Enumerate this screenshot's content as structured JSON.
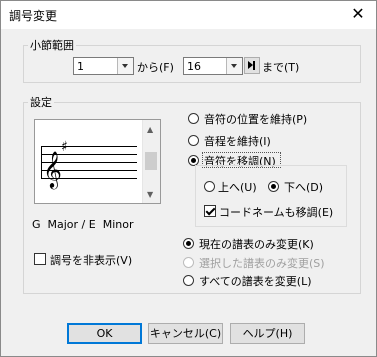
{
  "window": {
    "title": "調号変更",
    "close_icon": "close-icon"
  },
  "measure_range": {
    "legend": "小節範囲",
    "from_value": "1",
    "from_label": "から(F)",
    "to_value": "16",
    "to_label": "まで(T)"
  },
  "settings": {
    "legend": "設定",
    "key_label": "G  Major / E  Minor",
    "hide_key_label": "調号を非表示(V)",
    "pitch_options": [
      {
        "label": "音符の位置を維持(P)",
        "checked": false
      },
      {
        "label": "音程を維持(I)",
        "checked": false
      },
      {
        "label": "音符を移調(N)",
        "checked": true
      }
    ],
    "direction_up_label": "上へ(U)",
    "direction_down_label": "下へ(D)",
    "transpose_chord_label": "コードネームも移調(E)",
    "scope_options": [
      {
        "label": "現在の譜表のみ変更(K)",
        "checked": true,
        "enabled": true
      },
      {
        "label": "選択した譜表のみ変更(S)",
        "checked": false,
        "enabled": false
      },
      {
        "label": "すべての譜表を変更(L)",
        "checked": false,
        "enabled": true
      }
    ]
  },
  "buttons": {
    "ok": "OK",
    "cancel": "キャンセル(C)",
    "help": "ヘルプ(H)"
  }
}
